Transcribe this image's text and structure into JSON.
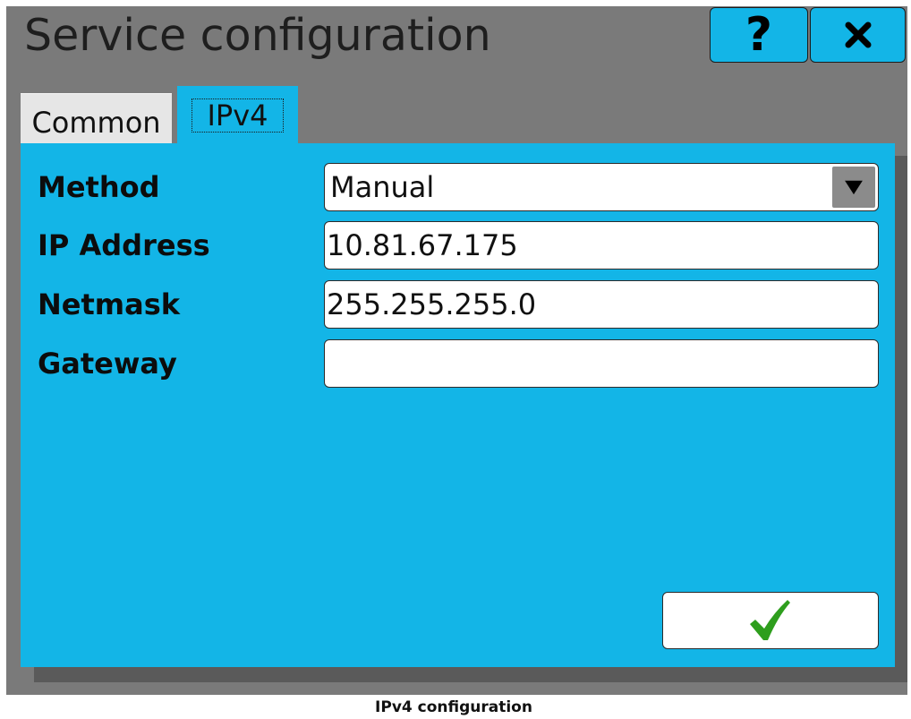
{
  "window": {
    "title": "Service configuration",
    "help_button": {
      "label": "?",
      "icon": "question-mark-icon"
    },
    "close_button": {
      "icon": "close-icon"
    }
  },
  "tabs": [
    {
      "label": "Common",
      "active": false
    },
    {
      "label": "IPv4",
      "active": true
    }
  ],
  "form": {
    "method": {
      "label": "Method",
      "value": "Manual",
      "toggle_icon": "triangle-down-icon"
    },
    "ip_address": {
      "label": "IP Address",
      "value": "10.81.67.175"
    },
    "netmask": {
      "label": "Netmask",
      "value": "255.255.255.0"
    },
    "gateway": {
      "label": "Gateway",
      "value": ""
    }
  },
  "confirm_button": {
    "icon": "checkmark-icon"
  },
  "caption": "IPv4 configuration",
  "colors": {
    "panel_accent": "#13b5e7",
    "window_background": "#7a7a7a",
    "panel_shadow": "#5a5a5a",
    "inactive_tab": "#e6e6e6",
    "checkmark": "#2e9e1d"
  }
}
